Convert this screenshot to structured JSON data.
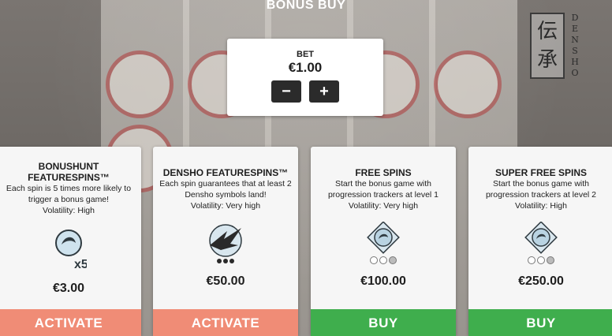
{
  "title": "BONUS BUY",
  "logo": {
    "kanji": [
      "伝",
      "承"
    ],
    "word": [
      "D",
      "E",
      "N",
      "S",
      "H",
      "O"
    ]
  },
  "bet": {
    "label": "BET",
    "value": "€1.00",
    "minus": "−",
    "plus": "+"
  },
  "cards": [
    {
      "title": "BONUSHUNT FEATURESPINS™",
      "description": "Each spin is 5 times more likely to trigger a bonus game!",
      "volatility": "Volatility: High",
      "badge": "x5",
      "price": "€3.00",
      "button": "ACTIVATE",
      "button_color": "#f08c76"
    },
    {
      "title": "DENSHO FEATURESPINS™",
      "description": "Each spin guarantees that at least 2 Densho symbols land!",
      "volatility": "Volatility: Very high",
      "price": "€50.00",
      "button": "ACTIVATE",
      "button_color": "#f08c76"
    },
    {
      "title": "FREE SPINS",
      "description": "Start the bonus game with progression trackers at level 1",
      "volatility": "Volatility: Very high",
      "tracker_level": 1,
      "price": "€100.00",
      "button": "BUY",
      "button_color": "#3fae4d"
    },
    {
      "title": "SUPER FREE SPINS",
      "description": "Start the bonus game with progression trackers at level 2",
      "volatility": "Volatility: High",
      "tracker_level": 2,
      "price": "€250.00",
      "button": "BUY",
      "button_color": "#3fae4d"
    }
  ]
}
